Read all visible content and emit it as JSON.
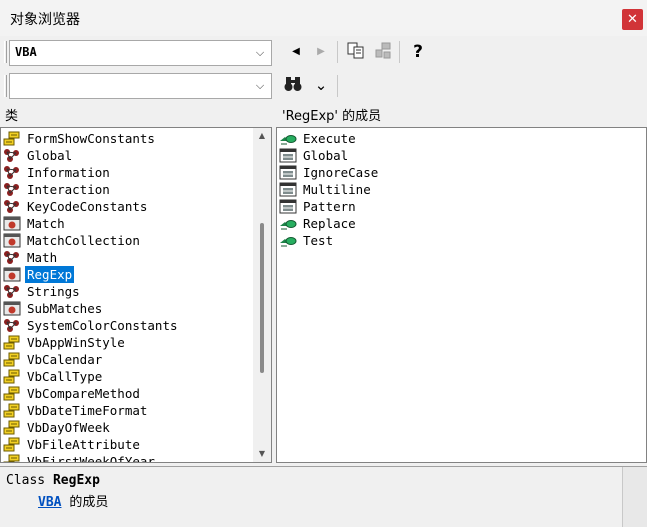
{
  "window": {
    "title": "对象浏览器",
    "close_glyph": "✕"
  },
  "toolbar": {
    "library_value": "VBA",
    "search_value": "",
    "combo_arrow": "⌵",
    "back_glyph": "◀",
    "forward_glyph": "▶",
    "help_glyph": "?",
    "search_glyph": "🔍",
    "toggle_glyph": "⌄"
  },
  "classes_pane": {
    "header": "类",
    "items": [
      {
        "label": "FormShowConstants",
        "icon": "enum-icon"
      },
      {
        "label": "Global",
        "icon": "module-icon"
      },
      {
        "label": "Information",
        "icon": "module-icon"
      },
      {
        "label": "Interaction",
        "icon": "module-icon"
      },
      {
        "label": "KeyCodeConstants",
        "icon": "module-icon"
      },
      {
        "label": "Match",
        "icon": "class-icon"
      },
      {
        "label": "MatchCollection",
        "icon": "class-icon"
      },
      {
        "label": "Math",
        "icon": "module-icon"
      },
      {
        "label": "RegExp",
        "icon": "class-icon",
        "selected": true
      },
      {
        "label": "Strings",
        "icon": "module-icon"
      },
      {
        "label": "SubMatches",
        "icon": "class-icon"
      },
      {
        "label": "SystemColorConstants",
        "icon": "module-icon"
      },
      {
        "label": "VbAppWinStyle",
        "icon": "enum-icon"
      },
      {
        "label": "VbCalendar",
        "icon": "enum-icon"
      },
      {
        "label": "VbCallType",
        "icon": "enum-icon"
      },
      {
        "label": "VbCompareMethod",
        "icon": "enum-icon"
      },
      {
        "label": "VbDateTimeFormat",
        "icon": "enum-icon"
      },
      {
        "label": "VbDayOfWeek",
        "icon": "enum-icon"
      },
      {
        "label": "VbFileAttribute",
        "icon": "enum-icon"
      },
      {
        "label": "VbFirstWeekOfYear",
        "icon": "enum-icon"
      }
    ]
  },
  "members_pane": {
    "header": "'RegExp' 的成员",
    "items": [
      {
        "label": "Execute",
        "icon": "method-icon"
      },
      {
        "label": "Global",
        "icon": "property-icon"
      },
      {
        "label": "IgnoreCase",
        "icon": "property-icon"
      },
      {
        "label": "Multiline",
        "icon": "property-icon"
      },
      {
        "label": "Pattern",
        "icon": "property-icon"
      },
      {
        "label": "Replace",
        "icon": "method-icon"
      },
      {
        "label": "Test",
        "icon": "method-icon"
      }
    ]
  },
  "details": {
    "line1_prefix": "Class",
    "line1_name": "RegExp",
    "line2_link": "VBA",
    "line2_suffix": "的成员"
  },
  "colors": {
    "selection": "#0078d7",
    "link": "#0050c0",
    "close": "#d13438"
  }
}
